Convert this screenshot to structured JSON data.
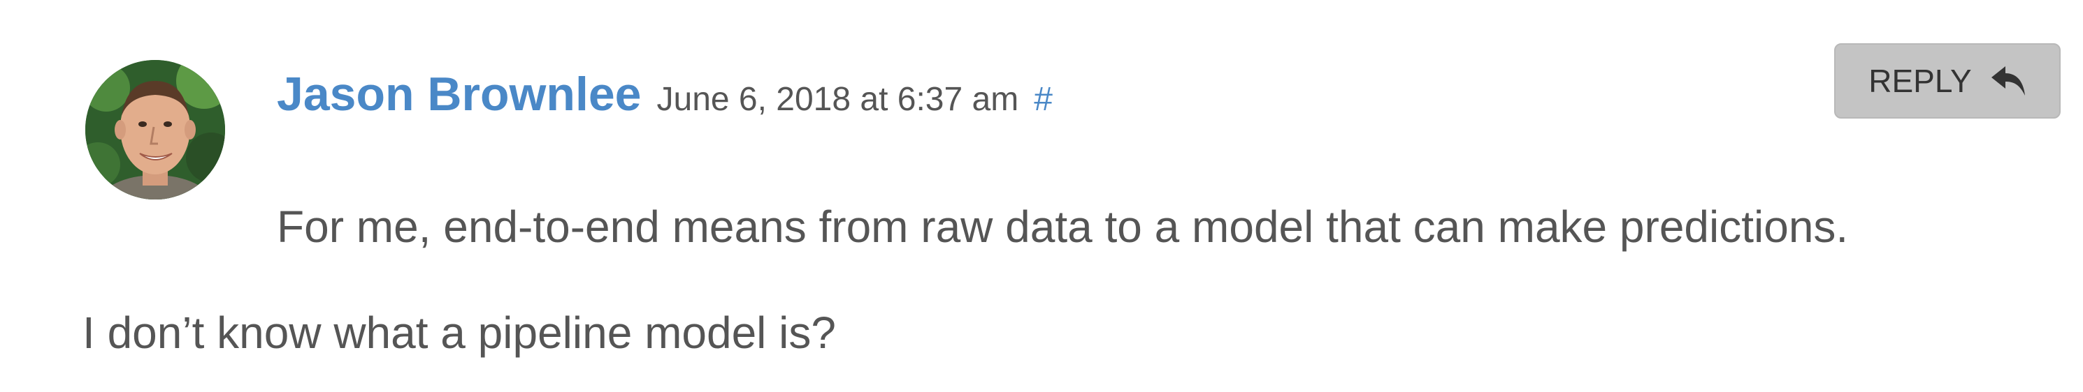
{
  "comment": {
    "author": "Jason Brownlee",
    "date": "June 6, 2018 at 6:37 am",
    "permalink": "#",
    "reply_label": "REPLY",
    "paragraphs": [
      "For me, end-to-end means from raw data to a model that can make predictions.",
      "I don’t know what a pipeline model is?"
    ]
  },
  "icons": {
    "avatar": "author-avatar",
    "reply": "reply-arrow-icon"
  },
  "colors": {
    "author": "#4a88c7",
    "link": "#4a88c7",
    "text": "#555555",
    "reply_bg": "#c4c4c4"
  }
}
